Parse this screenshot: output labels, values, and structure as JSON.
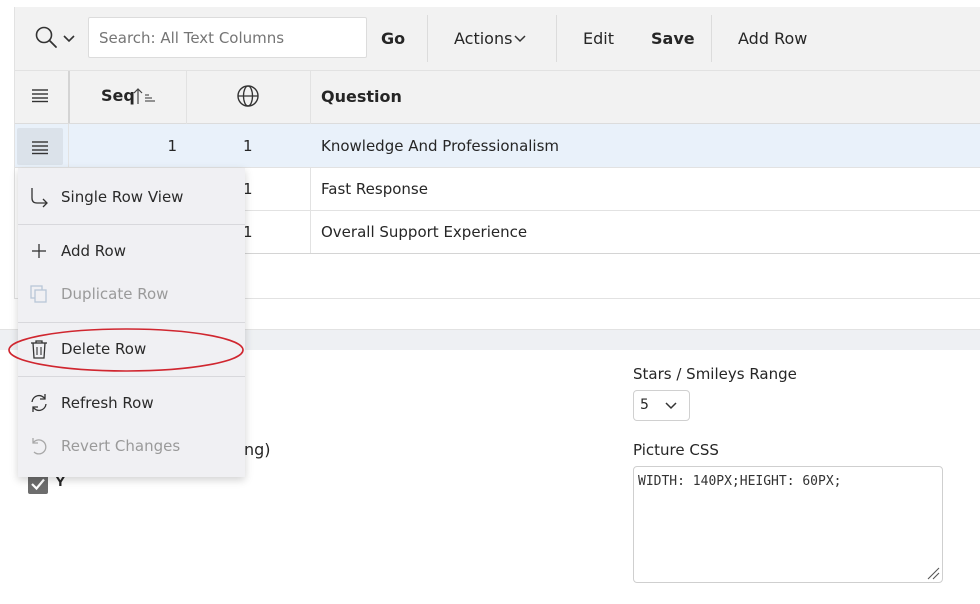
{
  "toolbar": {
    "search_placeholder": "Search: All Text Columns",
    "go_label": "Go",
    "actions_label": "Actions",
    "edit_label": "Edit",
    "save_label": "Save",
    "add_row_label": "Add Row"
  },
  "grid": {
    "col_seq": "Seq",
    "col_question": "Question",
    "rows": [
      {
        "seq": "1",
        "lang": "1",
        "question": "Knowledge And Professionalism"
      },
      {
        "seq": "",
        "lang": "1",
        "question": "Fast Response"
      },
      {
        "seq": "",
        "lang": "1",
        "question": "Overall Support Experience"
      }
    ]
  },
  "row_menu": {
    "items": [
      {
        "label": "Single Row View",
        "icon": "return-arrow-icon",
        "enabled": true
      },
      {
        "label": "Add Row",
        "icon": "plus-icon",
        "enabled": true
      },
      {
        "label": "Duplicate Row",
        "icon": "copy-icon",
        "enabled": false
      },
      {
        "label": "Delete Row",
        "icon": "trash-icon",
        "enabled": true
      },
      {
        "label": "Refresh Row",
        "icon": "refresh-icon",
        "enabled": true
      },
      {
        "label": "Revert Changes",
        "icon": "undo-icon",
        "enabled": false
      }
    ],
    "highlight_color": "#d0262f"
  },
  "form": {
    "partial_label": "ng)",
    "checkbox_label": "Y",
    "checkbox_checked": true,
    "stars_label": "Stars / Smileys Range",
    "stars_value": "5",
    "picture_css_label": "Picture CSS",
    "picture_css_value": "WIDTH: 140PX;HEIGHT: 60PX;"
  }
}
